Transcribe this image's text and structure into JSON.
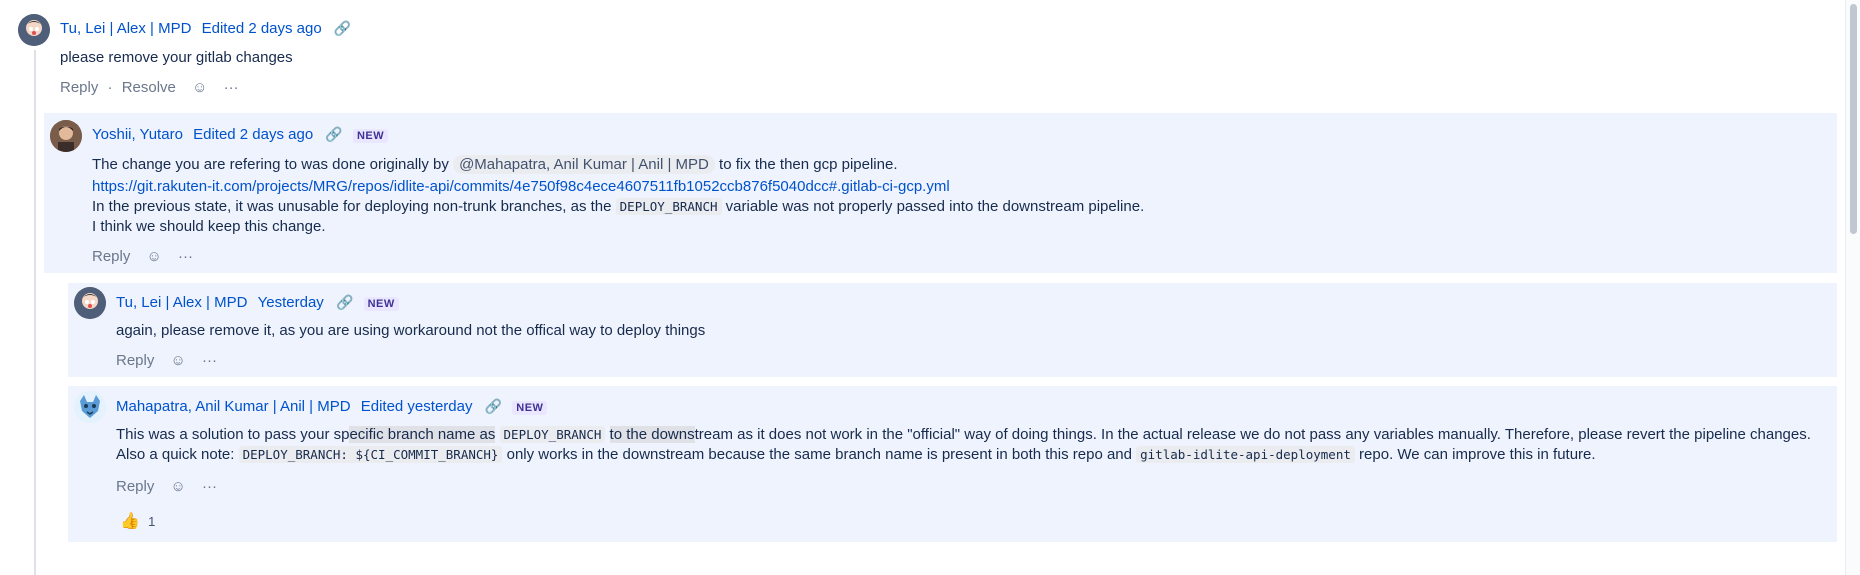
{
  "comments": [
    {
      "author": "Tu, Lei | Alex | MPD",
      "meta": "Edited 2 days ago",
      "body": "please remove your gitlab changes",
      "actions": {
        "reply": "Reply",
        "resolve": "Resolve",
        "separator": "·"
      }
    },
    {
      "author": "Yoshii, Yutaro",
      "meta": "Edited 2 days ago",
      "tag": "NEW",
      "body": {
        "line1_pre": "The change you are refering to was done originally by",
        "mention": "@Mahapatra, Anil Kumar | Anil | MPD",
        "line1_post": "to fix the then gcp pipeline.",
        "url": "https://git.rakuten-it.com/projects/MRG/repos/idlite-api/commits/4e750f98c4ece4607511fb1052ccb876f5040dcc#.gitlab-ci-gcp.yml",
        "line3_pre": "In the previous state, it was unusable for deploying non-trunk branches, as the",
        "line3_code": "DEPLOY_BRANCH",
        "line3_post": "variable was not properly passed into the downstream pipeline.",
        "line4": "I think we should keep this change."
      },
      "actions": {
        "reply": "Reply"
      }
    },
    {
      "author": "Tu, Lei | Alex | MPD",
      "meta": "Yesterday",
      "tag": "NEW",
      "body": "again, please remove it, as you are using workaround not the offical way to deploy things",
      "actions": {
        "reply": "Reply"
      }
    },
    {
      "author": "Mahapatra, Anil Kumar | Anil | MPD",
      "meta": "Edited yesterday",
      "tag": "NEW",
      "body": {
        "p1": "This was a solution to pass your sp",
        "p1_hl": "ecific branch name as",
        "code1": "DEPLOY_BRANCH",
        "p2_hl": "to the downs",
        "p2": "tream as it does not work in the \"official\" way of doing things. In the actual release we do not pass any variables manually. Therefore, please revert the pipeline changes. Also a quick note:",
        "code2": "DEPLOY_BRANCH: ${CI_COMMIT_BRANCH}",
        "p3": "only works in the downstream because the same branch name is present in both this repo and",
        "code3": "gitlab-idlite-api-deployment",
        "p4": "repo. We can improve this in future."
      },
      "actions": {
        "reply": "Reply"
      },
      "reaction": {
        "emoji": "👍",
        "count": "1"
      }
    }
  ],
  "icons": {
    "link": "link-icon",
    "reaction": "add-reaction-icon",
    "more": "more-actions-icon",
    "thumbsup": "thumbs-up-icon"
  }
}
